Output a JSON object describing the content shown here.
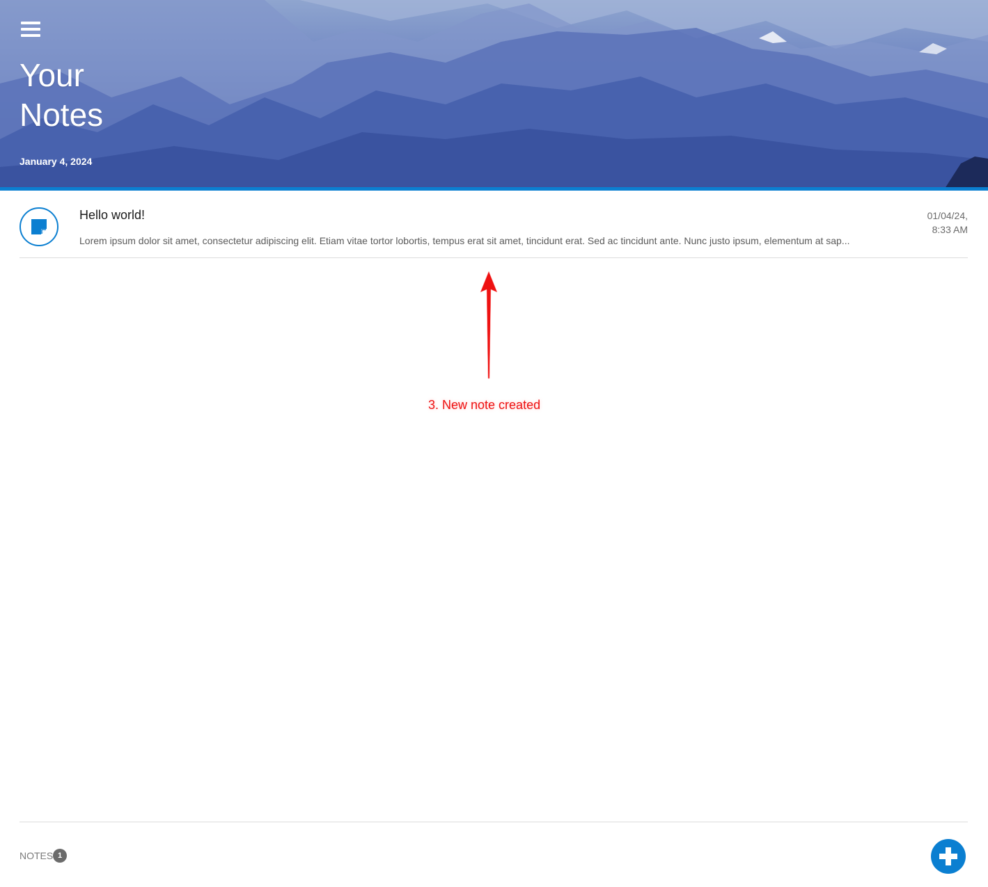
{
  "header": {
    "menu_icon": "hamburger-menu-icon",
    "title": "Your Notes",
    "date": "January 4, 2024",
    "accent_color": "#0b7fd1"
  },
  "notes": [
    {
      "icon": "sticky-note-icon",
      "title": "Hello world!",
      "preview": "Lorem ipsum dolor sit amet, consectetur adipiscing elit. Etiam vitae tortor lobortis, tempus erat sit amet, tincidunt erat. Sed ac tincidunt ante. Nunc justo ipsum, elementum at sap...",
      "date_line1": "01/04/24,",
      "date_line2": "8:33 AM"
    }
  ],
  "annotation": {
    "text": "3. New note created",
    "color": "#ee1111"
  },
  "footer": {
    "notes_label": "NOTES",
    "notes_count": "1",
    "add_icon": "plus-icon"
  }
}
